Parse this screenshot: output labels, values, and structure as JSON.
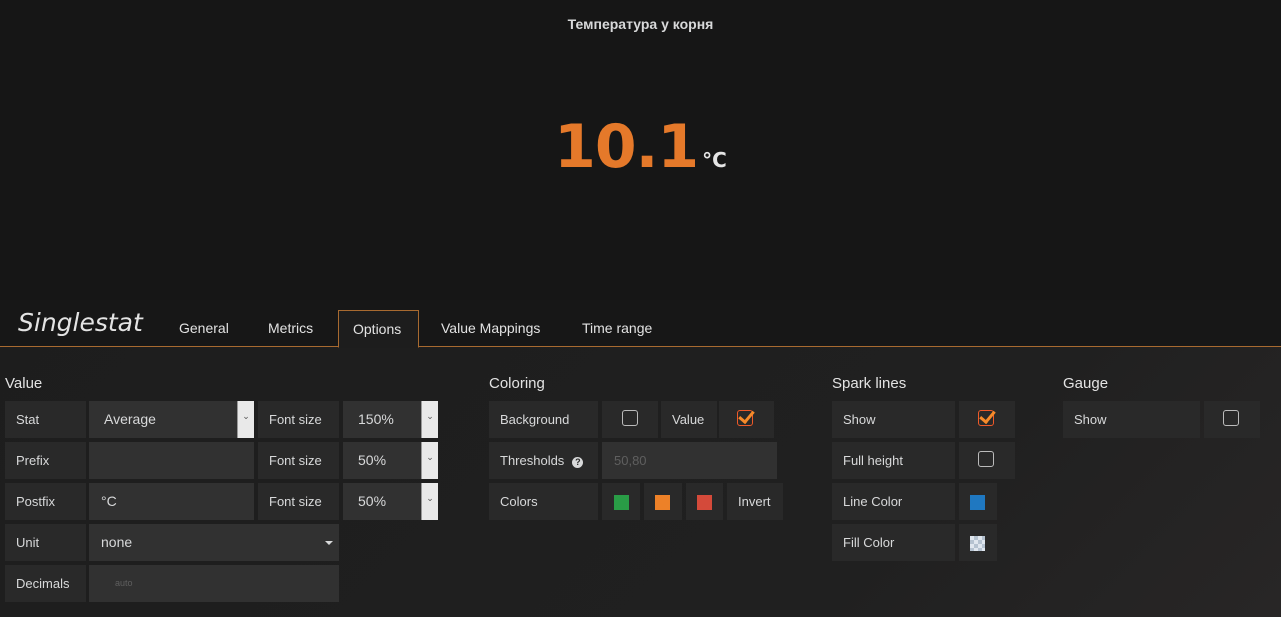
{
  "panel": {
    "title": "Температура у корня",
    "value": "10.1",
    "unit": "°C"
  },
  "editor": {
    "title": "Singlestat",
    "tabs": [
      "General",
      "Metrics",
      "Options",
      "Value Mappings",
      "Time range"
    ],
    "active_tab": "Options"
  },
  "value_section": {
    "title": "Value",
    "stat_label": "Stat",
    "stat_value": "Average",
    "prefix_label": "Prefix",
    "prefix_value": "",
    "postfix_label": "Postfix",
    "postfix_value": "°C",
    "unit_label": "Unit",
    "unit_value": "none",
    "decimals_label": "Decimals",
    "decimals_placeholder": "auto",
    "font_size_label": "Font size",
    "value_font_size": "150%",
    "prefix_font_size": "50%",
    "postfix_font_size": "50%"
  },
  "coloring": {
    "title": "Coloring",
    "background_label": "Background",
    "background_checked": false,
    "value_label": "Value",
    "value_checked": true,
    "thresholds_label": "Thresholds",
    "thresholds_placeholder": "50,80",
    "colors_label": "Colors",
    "colors": [
      "#299c46",
      "#ed8128",
      "#d44a3a"
    ],
    "invert_label": "Invert"
  },
  "spark_lines": {
    "title": "Spark lines",
    "show_label": "Show",
    "show_checked": true,
    "full_height_label": "Full height",
    "full_height_checked": false,
    "line_color_label": "Line Color",
    "line_color": "#1f78c1",
    "fill_color_label": "Fill Color"
  },
  "gauge": {
    "title": "Gauge",
    "show_label": "Show",
    "show_checked": false
  }
}
